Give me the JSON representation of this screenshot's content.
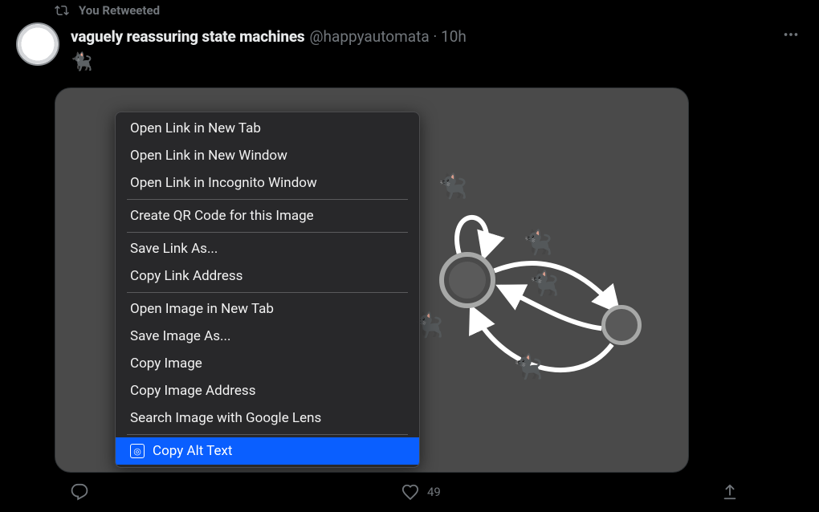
{
  "retweet_label": "You Retweeted",
  "tweet": {
    "display_name": "vaguely reassuring state machines",
    "handle": "@happyautomata",
    "dot": "·",
    "time": "10h",
    "body_emoji": "🐈‍⬛",
    "likes": "49"
  },
  "cats": [
    "🐈‍⬛",
    "🐈‍⬛",
    "🐈‍⬛",
    "🐈‍⬛",
    "🐈‍⬛"
  ],
  "context_menu": {
    "groups": [
      [
        "Open Link in New Tab",
        "Open Link in New Window",
        "Open Link in Incognito Window"
      ],
      [
        "Create QR Code for this Image"
      ],
      [
        "Save Link As...",
        "Copy Link Address"
      ],
      [
        "Open Image in New Tab",
        "Save Image As...",
        "Copy Image",
        "Copy Image Address",
        "Search Image with Google Lens"
      ]
    ],
    "highlighted": "Copy Alt Text"
  }
}
